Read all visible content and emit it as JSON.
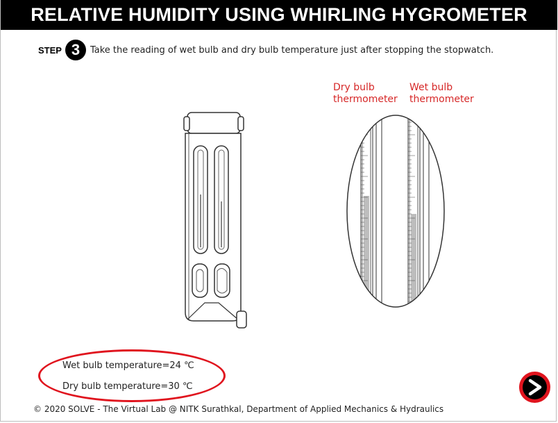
{
  "title": "RELATIVE HUMIDITY USING WHIRLING HYGROMETER",
  "step": {
    "label": "STEP",
    "number": "3",
    "instruction": "Take the reading of wet bulb and dry bulb temperature just after stopping the stopwatch."
  },
  "labels": {
    "dry_line1": "Dry bulb",
    "dry_line2": "thermometer",
    "wet_line1": "Wet bulb",
    "wet_line2": "thermometer"
  },
  "readings": {
    "wet": "Wet bulb temperature=24 ℃",
    "dry": "Dry bulb temperature=30 ℃"
  },
  "footer": "© 2020 SOLVE - The Virtual Lab @ NITK Surathkal, Department of Applied Mechanics & Hydraulics",
  "icons": {
    "next": "chevron-right-icon",
    "step_badge": "number-circle"
  },
  "colors": {
    "accent": "#e0141e",
    "label_red": "#d62828",
    "title_bg": "#000000"
  }
}
